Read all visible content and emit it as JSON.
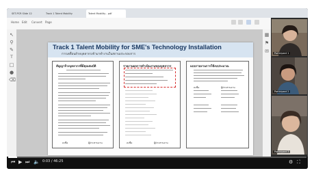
{
  "browser": {
    "tabs": [
      {
        "label": "SET-PCR Slide 12"
      },
      {
        "label": "Track 1 Talent Mobility"
      },
      {
        "label": "Talent Mobility - pdf"
      }
    ],
    "menu": [
      "Home",
      "Edit",
      "Convert",
      "Page"
    ]
  },
  "left_rail": {
    "icons": [
      "cursor-icon",
      "zoom-icon",
      "pen-icon",
      "text-icon",
      "shape-icon",
      "highlight-icon",
      "eraser-icon"
    ]
  },
  "slide": {
    "title": "Track 1 Talent Mobility for SME's Technology Installation",
    "subtitle": "การเคลื่อนย้ายบุคลากรเข้ามาทำงานในสถานประกอบการ"
  },
  "panels": [
    {
      "title": "สัญญาจ้างบุคลากรที่มีคุณสมบัติ",
      "stamp_left": "ลงชื่อ",
      "stamp_right": "ผู้ประสานงาน"
    },
    {
      "title": "รายงานผลการดำเนินงานของบุคลากร",
      "stamp_left": "ลงชื่อ",
      "stamp_right": "ผู้ประสานงาน"
    },
    {
      "title": "แบบรายงานการใช้งบประมาณ",
      "stamp_left": "ลงชื่อ",
      "stamp_right": "ผู้ประสานงาน"
    }
  ],
  "player": {
    "time": "0:03 / 46:25",
    "progress": 0.03,
    "controls": [
      "prev-icon",
      "play-icon",
      "next-icon",
      "volume-icon"
    ],
    "right_controls": [
      "settings-icon",
      "fullscreen-icon"
    ]
  },
  "participants": [
    {
      "name": "Participant 1"
    },
    {
      "name": "Participant 2"
    },
    {
      "name": "Participant 3"
    }
  ],
  "colors": {
    "banner": "#d7e4f1",
    "title": "#16355f",
    "dashed_highlight": "#d52a2a"
  }
}
